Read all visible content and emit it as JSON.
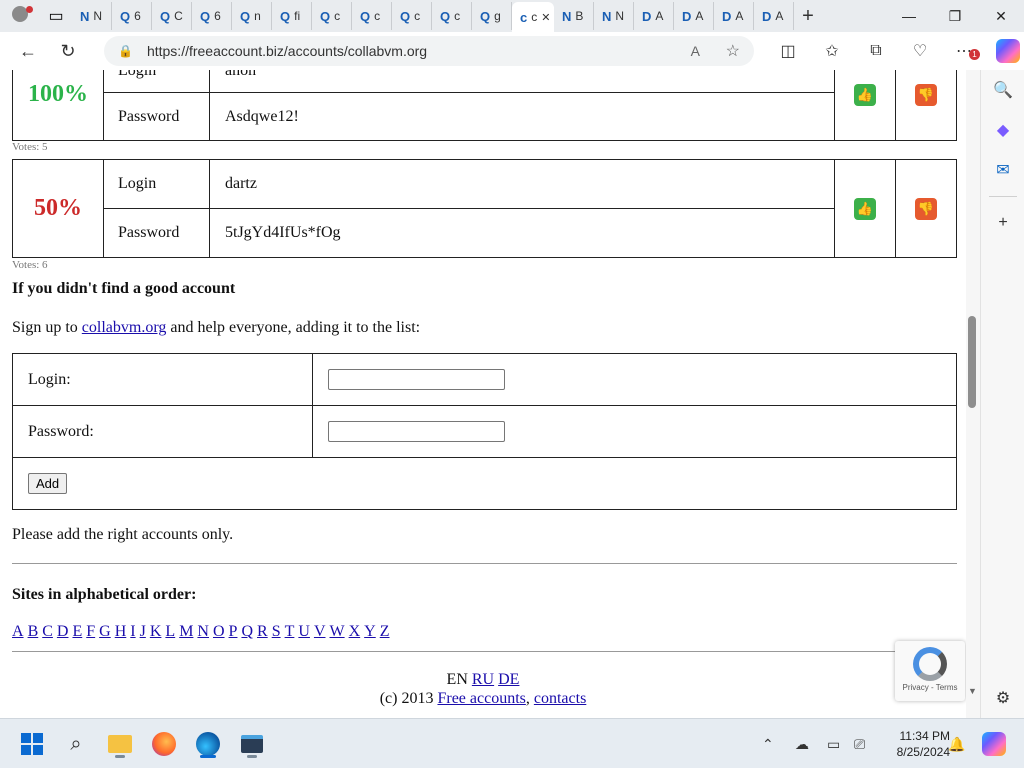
{
  "browser": {
    "tabs": [
      {
        "icon": "N",
        "label": "N"
      },
      {
        "icon": "Q",
        "label": "6"
      },
      {
        "icon": "Q",
        "label": "C"
      },
      {
        "icon": "Q",
        "label": "6"
      },
      {
        "icon": "Q",
        "label": "n"
      },
      {
        "icon": "Q",
        "label": "fi"
      },
      {
        "icon": "Q",
        "label": "c"
      },
      {
        "icon": "Q",
        "label": "c"
      },
      {
        "icon": "Q",
        "label": "c"
      },
      {
        "icon": "Q",
        "label": "c"
      },
      {
        "icon": "Q",
        "label": "g"
      },
      {
        "icon": "c",
        "label": "c"
      },
      {
        "icon": "N",
        "label": "B"
      },
      {
        "icon": "N",
        "label": "N"
      },
      {
        "icon": "D",
        "label": "A"
      },
      {
        "icon": "D",
        "label": "A"
      },
      {
        "icon": "D",
        "label": "A"
      },
      {
        "icon": "D",
        "label": "A"
      }
    ],
    "url": "https://freeaccount.biz/accounts/collabvm.org"
  },
  "accounts": [
    {
      "percent": "100%",
      "login_label": "Login",
      "login": "anon",
      "password_label": "Password",
      "password": "Asdqwe12!",
      "votes": "Votes: 5",
      "color": "#2bb34a"
    },
    {
      "percent": "50%",
      "login_label": "Login",
      "login": "dartz",
      "password_label": "Password",
      "password": "5tJgYd4IfUs*fOg",
      "votes": "Votes: 6",
      "color": "#cc2a2a"
    }
  ],
  "add_section": {
    "heading": "If you didn't find a good account",
    "intro_before": "Sign up to ",
    "intro_link": "collabvm.org",
    "intro_after": " and help everyone, adding it to the list:",
    "login_label": "Login:",
    "password_label": "Password:",
    "add_button": "Add",
    "note": "Please add the right accounts only."
  },
  "sites": {
    "heading": "Sites in alphabetical order:",
    "letters": [
      "A",
      "B",
      "C",
      "D",
      "E",
      "F",
      "G",
      "H",
      "I",
      "J",
      "K",
      "L",
      "M",
      "N",
      "O",
      "P",
      "Q",
      "R",
      "S",
      "T",
      "U",
      "V",
      "W",
      "X",
      "Y",
      "Z"
    ]
  },
  "footer": {
    "lang_en": "EN",
    "lang_ru": "RU",
    "lang_de": "DE",
    "copyright": "(c) 2013 ",
    "free_accounts": "Free accounts",
    "comma": ", ",
    "contacts": "contacts"
  },
  "recaptcha": {
    "links": "Privacy - Terms"
  },
  "taskbar": {
    "time": "11:34 PM",
    "date": "8/25/2024"
  }
}
